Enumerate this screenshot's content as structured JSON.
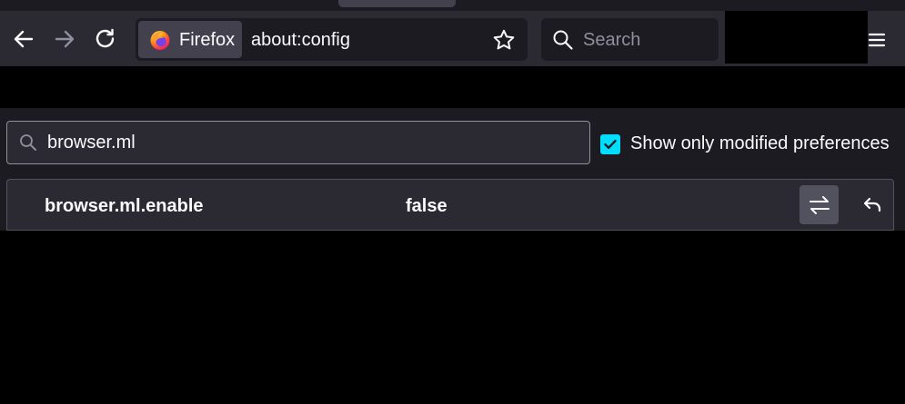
{
  "toolbar": {
    "identity_label": "Firefox",
    "url": "about:config",
    "search_placeholder": "Search"
  },
  "config": {
    "search_value": "browser.ml",
    "show_modified_label": "Show only modified preferences",
    "show_modified_checked": true,
    "rows": [
      {
        "name": "browser.ml.enable",
        "value": "false"
      }
    ]
  },
  "colors": {
    "accent": "#00ddff",
    "toolbar_bg": "#2b2a33",
    "field_bg": "#1c1b22"
  },
  "icons": [
    "back-arrow-icon",
    "forward-arrow-icon",
    "reload-icon",
    "firefox-logo-icon",
    "bookmark-star-icon",
    "search-icon",
    "hamburger-menu-icon",
    "checkmark-icon",
    "toggle-icon",
    "reset-icon"
  ]
}
